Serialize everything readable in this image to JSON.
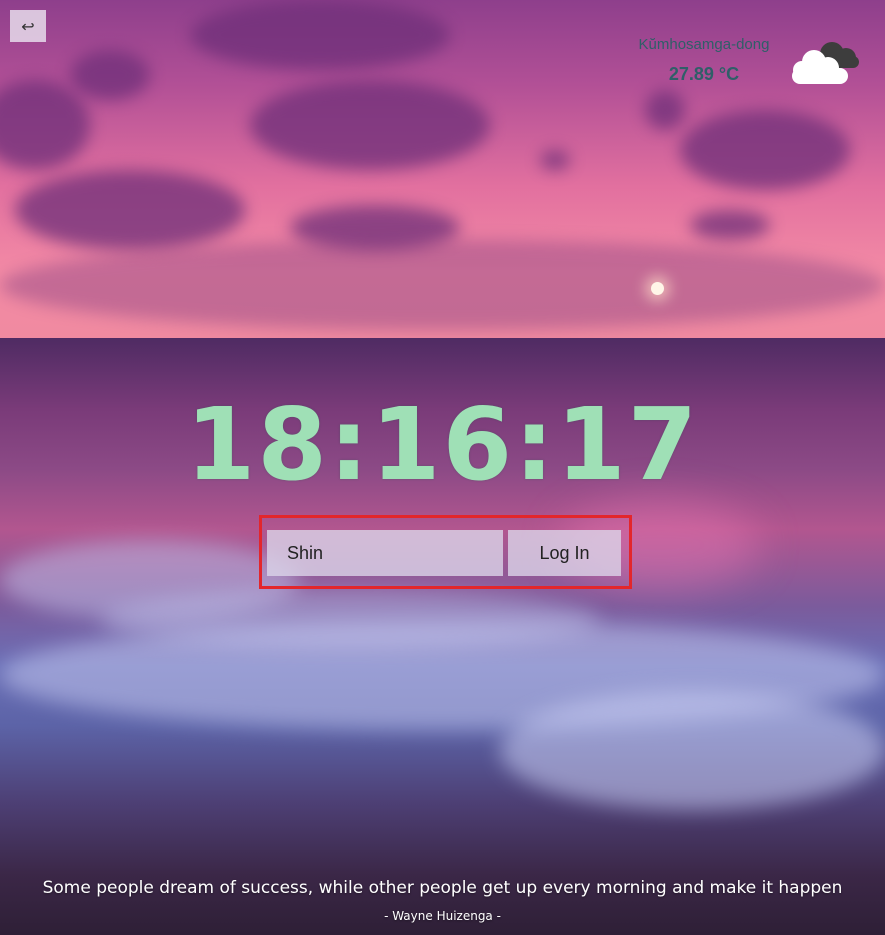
{
  "navigation": {
    "back_symbol": "↩"
  },
  "weather": {
    "city": "Kŭmhosamga-dong",
    "temperature": "27.89 °C",
    "icon": "cloud-icon"
  },
  "clock": {
    "time": "18:16:17"
  },
  "login": {
    "name_value": "Shin",
    "button_label": "Log In"
  },
  "quote": {
    "text": "Some people dream of success, while other people get up every morning and make it happen",
    "author": "- Wayne Huizenga -"
  },
  "colors": {
    "clock_text": "#9fe0b6",
    "weather_text": "#2f5f68",
    "highlight_border": "#e3262b"
  }
}
